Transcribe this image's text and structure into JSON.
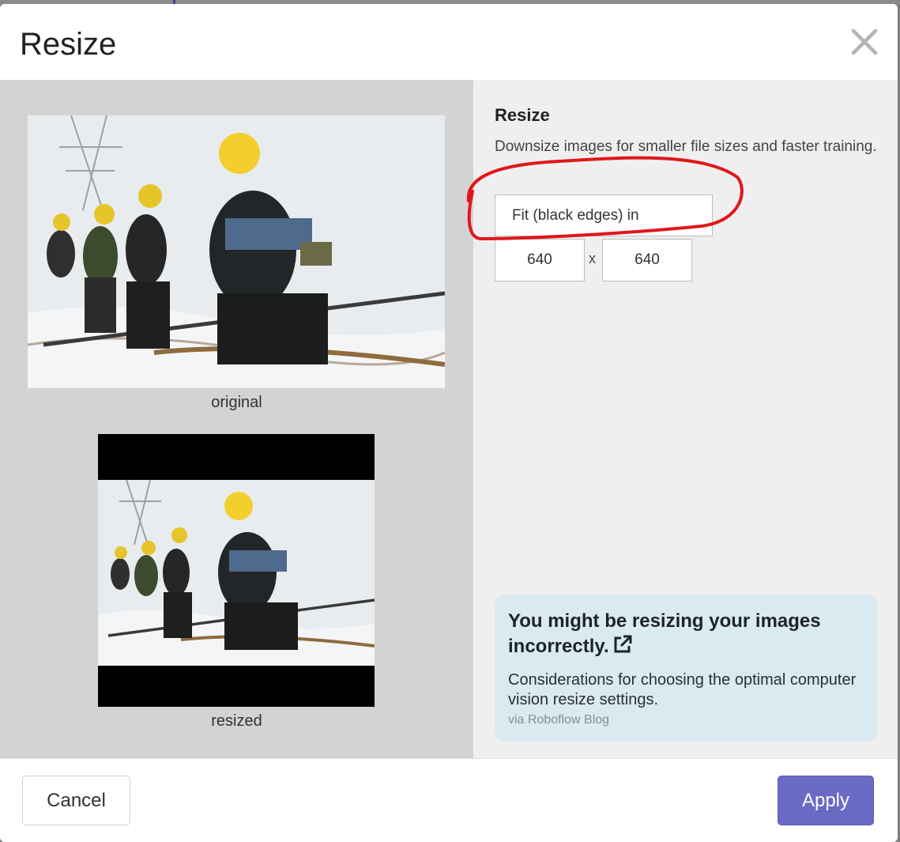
{
  "dialog": {
    "title": "Resize"
  },
  "preview": {
    "original_caption": "original",
    "resized_caption": "resized"
  },
  "settings": {
    "heading": "Resize",
    "description": "Downsize images for smaller file sizes and faster training.",
    "mode_value": "Fit (black edges) in",
    "width_value": "640",
    "height_value": "640",
    "separator": "x"
  },
  "tip": {
    "title": "You might be resizing your images incorrectly.",
    "text": "Considerations for choosing the optimal computer vision resize settings.",
    "source": "via Roboflow Blog",
    "icon": "external-link-icon"
  },
  "footer": {
    "cancel_label": "Cancel",
    "apply_label": "Apply"
  },
  "colors": {
    "apply_button": "#6a6ac4",
    "annotation": "#e0161b",
    "tip_background": "#d9eaf1",
    "preview_background": "#d3d3d3",
    "settings_background": "#efefef"
  }
}
